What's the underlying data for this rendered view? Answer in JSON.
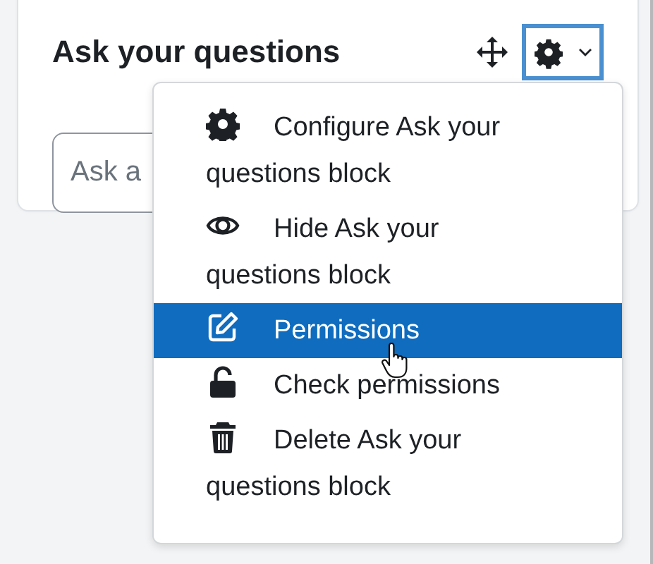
{
  "block": {
    "title": "Ask your questions",
    "input": {
      "placeholder": "Ask a"
    }
  },
  "menu": {
    "expanded": true,
    "items": [
      {
        "kind": "gear",
        "label": "Configure Ask your questions block",
        "selected": false
      },
      {
        "kind": "eye",
        "label": "Hide Ask your questions block",
        "selected": false
      },
      {
        "kind": "pencil",
        "label": "Permissions",
        "selected": true
      },
      {
        "kind": "unlock",
        "label": "Check permissions",
        "selected": false
      },
      {
        "kind": "trash",
        "label": "Delete Ask your questions block",
        "selected": false
      }
    ]
  }
}
